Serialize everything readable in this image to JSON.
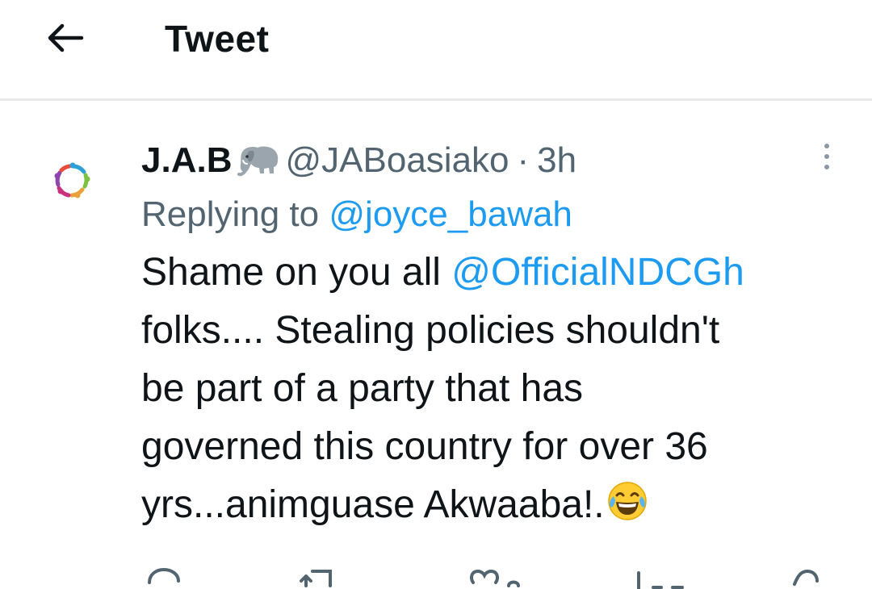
{
  "header": {
    "title": "Tweet",
    "back_icon": "arrow-left-icon"
  },
  "tweet": {
    "avatar_icon": "colorful-ring-logo-avatar",
    "author_name": "J.A.B",
    "author_badge_icon": "elephant-emoji",
    "handle": "@JABoasiako",
    "separator": "·",
    "time": "3h",
    "more_icon": "more-vertical-icon",
    "reply_prefix": "Replying to",
    "reply_to": "@joyce_bawah",
    "text_line1_prefix": "Shame on you all",
    "text_mention": "@OfficialNDCGh",
    "text_line2": "folks.... Stealing policies shouldn't",
    "text_line3": "be part of a party that has",
    "text_line4": "governed this country for over 36",
    "text_line5": "yrs...animguase Akwaaba!.",
    "text_emoji": "face-with-tears-of-joy-emoji"
  },
  "actions": {
    "icons": [
      "reply-icon",
      "retweet-icon",
      "like-icon",
      "views-icon",
      "share-icon"
    ]
  },
  "colors": {
    "text": "#0f1419",
    "secondary": "#536471",
    "link": "#1d9bf0",
    "divider": "#e7e9ea"
  }
}
